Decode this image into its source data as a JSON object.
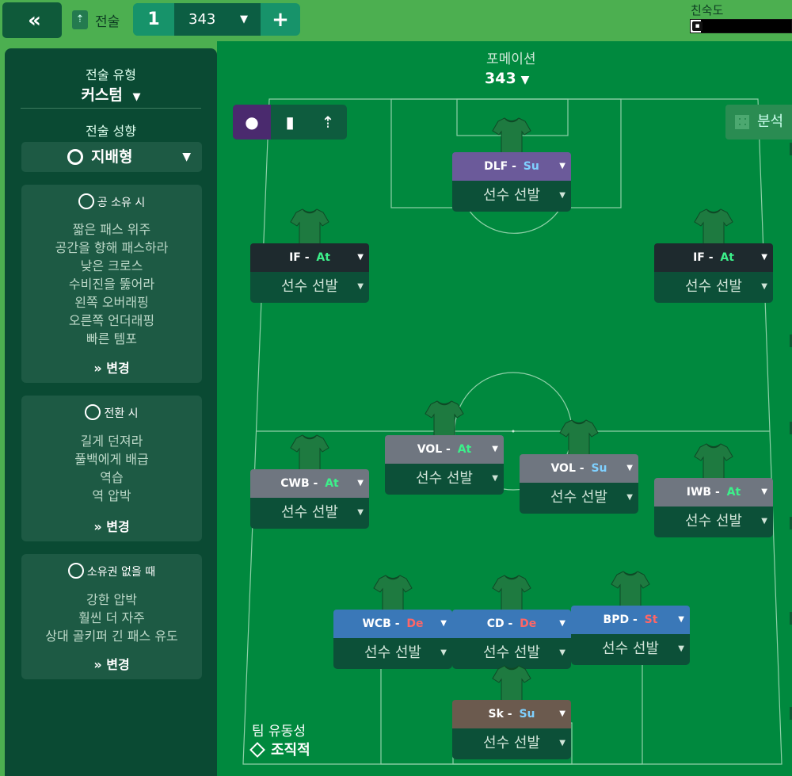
{
  "topbar": {
    "back_label": "«",
    "tactics_label": "전술",
    "slot_number": "1",
    "slot_name": "343",
    "add_label": "+",
    "familiarity_label": "친숙도",
    "familiarity_level": 0.1
  },
  "sidebar": {
    "style_heading": "전술 유형",
    "style_value": "커스텀",
    "mentality_heading": "전술 성향",
    "mentality_value": "지배형",
    "in_possession": {
      "title": "공 소유 시",
      "items": [
        "짧은 패스 위주",
        "공간을 향해 패스하라",
        "낮은 크로스",
        "수비진을 뚫어라",
        "왼쪽 오버래핑",
        "오른쪽 언더래핑",
        "빠른 템포"
      ],
      "change_label": "변경"
    },
    "in_transition": {
      "title": "전환 시",
      "items": [
        "길게 던져라",
        "풀백에게 배급",
        "역습",
        "역 압박"
      ],
      "change_label": "변경"
    },
    "out_of_possession": {
      "title": "소유권 없을 때",
      "items": [
        "강한 압박",
        "훨씬 더 자주",
        "상대 골키퍼 긴 패스 유도"
      ],
      "change_label": "변경"
    }
  },
  "main": {
    "formation_label": "포메이션",
    "formation_value": "343",
    "analysis_label": "분석",
    "fluidity_label": "팀 유동성",
    "fluidity_value": "조직적"
  },
  "players": [
    {
      "role": "DLF",
      "duty": "Su",
      "pick": "선수 선발",
      "role_bg": "#6b5a9a",
      "duty_color": "#7fd0ff"
    },
    {
      "role": "IF",
      "duty": "At",
      "pick": "선수 선발",
      "role_bg": "#1e2a2e",
      "duty_color": "#3cf08a"
    },
    {
      "role": "IF",
      "duty": "At",
      "pick": "선수 선발",
      "role_bg": "#1e2a2e",
      "duty_color": "#3cf08a"
    },
    {
      "role": "VOL",
      "duty": "At",
      "pick": "선수 선발",
      "role_bg": "#6f7680",
      "duty_color": "#3cf08a"
    },
    {
      "role": "VOL",
      "duty": "Su",
      "pick": "선수 선발",
      "role_bg": "#6f7680",
      "duty_color": "#7fd0ff"
    },
    {
      "role": "CWB",
      "duty": "At",
      "pick": "선수 선발",
      "role_bg": "#6f7680",
      "duty_color": "#3cf08a"
    },
    {
      "role": "IWB",
      "duty": "At",
      "pick": "선수 선발",
      "role_bg": "#6f7680",
      "duty_color": "#3cf08a"
    },
    {
      "role": "WCB",
      "duty": "De",
      "pick": "선수 선발",
      "role_bg": "#3a78b8",
      "duty_color": "#ff6666"
    },
    {
      "role": "CD",
      "duty": "De",
      "pick": "선수 선발",
      "role_bg": "#3a78b8",
      "duty_color": "#ff6666"
    },
    {
      "role": "BPD",
      "duty": "St",
      "pick": "선수 선발",
      "role_bg": "#3a78b8",
      "duty_color": "#ff6666"
    },
    {
      "role": "Sk",
      "duty": "Su",
      "pick": "선수 선발",
      "role_bg": "#6b5a4e",
      "duty_color": "#7fd0ff"
    }
  ]
}
